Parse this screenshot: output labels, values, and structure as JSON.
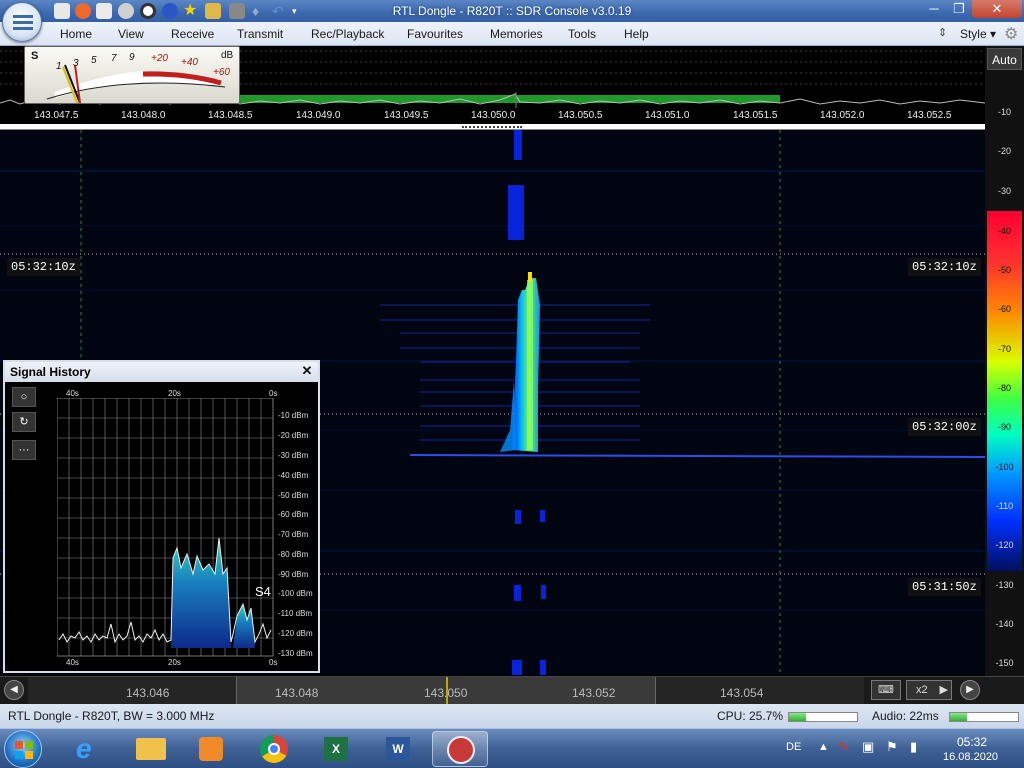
{
  "window": {
    "title": "RTL Dongle - R820T :: SDR Console v3.0.19"
  },
  "menu": {
    "items": [
      "Home",
      "View",
      "Receive",
      "Transmit",
      "Rec/Playback",
      "Favourites",
      "Memories",
      "Tools",
      "Help"
    ],
    "style_label": "Style"
  },
  "smeter": {
    "s_label": "S",
    "db_label": "dB",
    "scale": [
      "1",
      "3",
      "5",
      "7",
      "9",
      "+20",
      "+40",
      "+60"
    ]
  },
  "freq_axis": [
    "143.047.5",
    "143.048.0",
    "143.048.5",
    "143.049.0",
    "143.049.5",
    "143.050.0",
    "143.050.5",
    "143.051.0",
    "143.051.5",
    "143.052.0",
    "143.052.5"
  ],
  "waterfall": {
    "time_labels": [
      "05:32:10z",
      "05:32:00z",
      "05:31:50z"
    ]
  },
  "scale": {
    "auto_label": "Auto",
    "db_values": [
      "-10",
      "-20",
      "-30",
      "-40",
      "-50",
      "-60",
      "-70",
      "-80",
      "-90",
      "-100",
      "-110",
      "-120",
      "-130",
      "-140",
      "-150"
    ]
  },
  "signal_history": {
    "title": "Signal History",
    "close_label": "✕",
    "time_top": [
      "40s",
      "20s",
      "0s"
    ],
    "time_bottom": [
      "40s",
      "20s",
      "0s"
    ],
    "dbm_labels": [
      "-10 dBm",
      "-20 dBm",
      "-30 dBm",
      "-40 dBm",
      "-50 dBm",
      "-60 dBm",
      "-70 dBm",
      "-80 dBm",
      "-90 dBm",
      "-100 dBm",
      "-110 dBm",
      "-120 dBm",
      "-130 dBm"
    ],
    "s_reading": "S4",
    "tool_labels": [
      "○",
      "↻",
      "···"
    ]
  },
  "tuning_bar": {
    "freqs": [
      "143.046",
      "143.048",
      "143.050",
      "143.052",
      "143.054"
    ],
    "zoom_label": "x2"
  },
  "status": {
    "device": "RTL Dongle - R820T, BW = 3.000 MHz",
    "cpu": "CPU: 25.7%",
    "cpu_level": 0.257,
    "audio": "Audio: 22ms",
    "audio_level": 0.25
  },
  "taskbar": {
    "lang": "DE",
    "time": "05:32",
    "date": "16.08.2020"
  },
  "colors": {
    "waterfall_bg": "#000512",
    "accent": "#3c69ae"
  }
}
